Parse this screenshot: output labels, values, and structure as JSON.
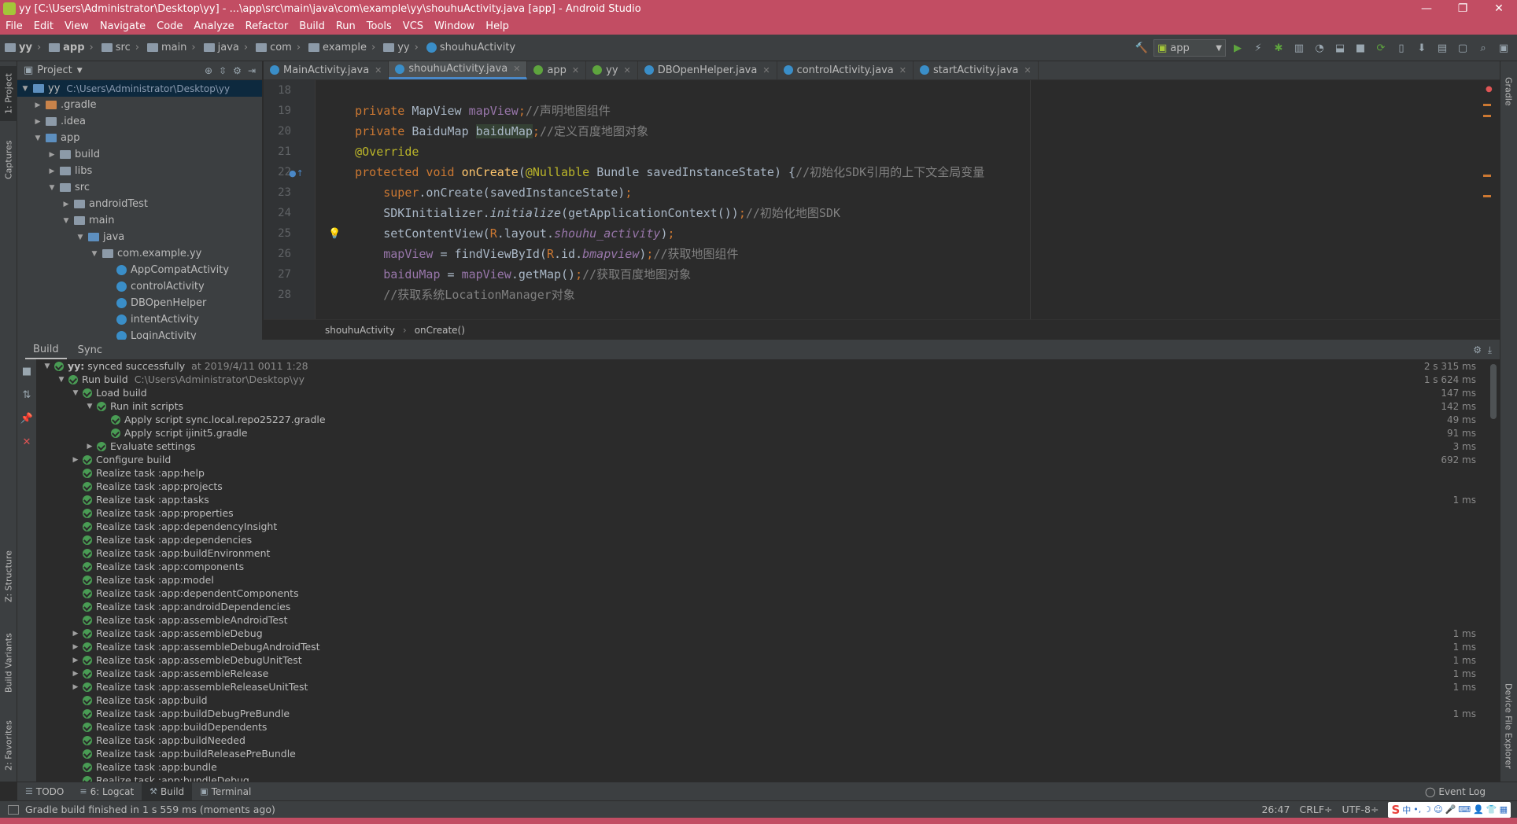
{
  "window": {
    "title": "yy [C:\\Users\\Administrator\\Desktop\\yy] - ...\\app\\src\\main\\java\\com\\example\\yy\\shouhuActivity.java [app] - Android Studio",
    "controls": {
      "minimize": "—",
      "restore": "❐",
      "close": "✕"
    }
  },
  "menu": [
    {
      "label": "File"
    },
    {
      "label": "Edit"
    },
    {
      "label": "View"
    },
    {
      "label": "Navigate"
    },
    {
      "label": "Code"
    },
    {
      "label": "Analyze"
    },
    {
      "label": "Refactor"
    },
    {
      "label": "Build"
    },
    {
      "label": "Run"
    },
    {
      "label": "Tools"
    },
    {
      "label": "VCS"
    },
    {
      "label": "Window"
    },
    {
      "label": "Help"
    }
  ],
  "nav": {
    "crumbs": [
      "yy",
      "app",
      "src",
      "main",
      "java",
      "com",
      "example",
      "yy",
      "shouhuActivity"
    ],
    "run_config": "app"
  },
  "left_stripe": {
    "project": "1: Project",
    "captures": "Captures",
    "structure": "Z: Structure",
    "build_variants": "Build Variants",
    "favorites": "2: Favorites"
  },
  "right_stripe": {
    "gradle": "Gradle",
    "device_file_explorer": "Device File Explorer"
  },
  "project_panel": {
    "title": "Project",
    "tree": [
      {
        "label": "yy",
        "path": "C:\\Users\\Administrator\\Desktop\\yy"
      },
      {
        "label": ".gradle"
      },
      {
        "label": ".idea"
      },
      {
        "label": "app"
      },
      {
        "label": "build"
      },
      {
        "label": "libs"
      },
      {
        "label": "src"
      },
      {
        "label": "androidTest"
      },
      {
        "label": "main"
      },
      {
        "label": "java"
      },
      {
        "label": "com.example.yy"
      },
      {
        "label": "AppCompatActivity"
      },
      {
        "label": "controlActivity"
      },
      {
        "label": "DBOpenHelper"
      },
      {
        "label": "intentActivity"
      },
      {
        "label": "LoginActivity"
      }
    ]
  },
  "editor": {
    "tabs": [
      {
        "label": "MainActivity.java"
      },
      {
        "label": "shouhuActivity.java"
      },
      {
        "label": "app"
      },
      {
        "label": "yy"
      },
      {
        "label": "DBOpenHelper.java"
      },
      {
        "label": "controlActivity.java"
      },
      {
        "label": "startActivity.java"
      }
    ],
    "line_numbers": [
      "18",
      "19",
      "20",
      "21",
      "22",
      "23",
      "24",
      "25",
      "26",
      "27",
      "28"
    ],
    "code": {
      "l19_a": "private ",
      "l19_b": "MapView ",
      "l19_c": "mapView",
      "l19_d": ";",
      "l19_e": "//声明地图组件",
      "l20_a": "private ",
      "l20_b": "BaiduMap ",
      "l20_c": "baiduMap",
      "l20_d": ";",
      "l20_e": "//定义百度地图对象",
      "l21": "@Override",
      "l22_a": "protected void ",
      "l22_b": "onCreate",
      "l22_c": "(",
      "l22_d": "@Nullable ",
      "l22_e": "Bundle savedInstanceState) {",
      "l22_f": "//初始化SDK引用的上下文全局变量",
      "l23_a": "super",
      "l23_b": ".onCreate(savedInstanceState)",
      "l23_c": ";",
      "l24_a": "SDKInitializer.",
      "l24_b": "initialize",
      "l24_c": "(getApplicationContext())",
      "l24_d": ";",
      "l24_e": "//初始化地图SDK",
      "l25_a": "setContentView(",
      "l25_b": "R",
      "l25_c": ".layout.",
      "l25_d": "shouhu_activity",
      "l25_e": ")",
      "l25_f": ";",
      "l26_a": "mapView",
      "l26_b": " = findViewById(",
      "l26_c": "R",
      "l26_d": ".id.",
      "l26_e": "bmapview",
      "l26_f": ")",
      "l26_g": ";",
      "l26_h": "//获取地图组件",
      "l27_a": "baiduMap",
      "l27_b": " = ",
      "l27_c": "mapView",
      "l27_d": ".getMap()",
      "l27_e": ";",
      "l27_f": "//获取百度地图对象",
      "l28": "//获取系统LocationManager对象"
    },
    "breadcrumb": [
      "shouhuActivity",
      "onCreate()"
    ]
  },
  "build": {
    "tabs": [
      "Build",
      "Sync"
    ],
    "rows": [
      {
        "label": "yy:",
        "extra": "synced successfully",
        "dim": "at 2019/4/11 0011 1:28",
        "time": "2 s 315 ms"
      },
      {
        "label": "Run build",
        "dim": "C:\\Users\\Administrator\\Desktop\\yy",
        "time": "1 s 624 ms"
      },
      {
        "label": "Load build",
        "time": "147 ms"
      },
      {
        "label": "Run init scripts",
        "time": "142 ms"
      },
      {
        "label": "Apply script sync.local.repo25227.gradle",
        "time": "49 ms"
      },
      {
        "label": "Apply script ijinit5.gradle",
        "time": "91 ms"
      },
      {
        "label": "Evaluate settings",
        "time": "3 ms"
      },
      {
        "label": "Configure build",
        "time": "692 ms"
      },
      {
        "label": "Realize task :app:help"
      },
      {
        "label": "Realize task :app:projects"
      },
      {
        "label": "Realize task :app:tasks",
        "time": "1 ms"
      },
      {
        "label": "Realize task :app:properties"
      },
      {
        "label": "Realize task :app:dependencyInsight"
      },
      {
        "label": "Realize task :app:dependencies"
      },
      {
        "label": "Realize task :app:buildEnvironment"
      },
      {
        "label": "Realize task :app:components"
      },
      {
        "label": "Realize task :app:model"
      },
      {
        "label": "Realize task :app:dependentComponents"
      },
      {
        "label": "Realize task :app:androidDependencies"
      },
      {
        "label": "Realize task :app:assembleAndroidTest"
      },
      {
        "label": "Realize task :app:assembleDebug",
        "time": "1 ms"
      },
      {
        "label": "Realize task :app:assembleDebugAndroidTest",
        "time": "1 ms"
      },
      {
        "label": "Realize task :app:assembleDebugUnitTest",
        "time": "1 ms"
      },
      {
        "label": "Realize task :app:assembleRelease",
        "time": "1 ms"
      },
      {
        "label": "Realize task :app:assembleReleaseUnitTest",
        "time": "1 ms"
      },
      {
        "label": "Realize task :app:build"
      },
      {
        "label": "Realize task :app:buildDebugPreBundle",
        "time": "1 ms"
      },
      {
        "label": "Realize task :app:buildDependents"
      },
      {
        "label": "Realize task :app:buildNeeded"
      },
      {
        "label": "Realize task :app:buildReleasePreBundle"
      },
      {
        "label": "Realize task :app:bundle"
      },
      {
        "label": "Realize task :app:bundleDebug"
      }
    ]
  },
  "bottom_tools": {
    "todo": "TODO",
    "logcat": "6: Logcat",
    "build": "Build",
    "terminal": "Terminal",
    "event_log": "Event Log"
  },
  "status": {
    "message": "Gradle build finished in 1 s 559 ms (moments ago)",
    "position": "26:47",
    "line_sep": "CRLF÷",
    "encoding": "UTF-8÷",
    "ime_label": "中"
  },
  "colors": {
    "title_bar": "#c24d63",
    "panel_bg": "#3c3f41",
    "editor_bg": "#2b2b2b",
    "keyword": "#cc7832",
    "comment": "#808080",
    "field": "#9876aa",
    "success": "#499c54"
  }
}
